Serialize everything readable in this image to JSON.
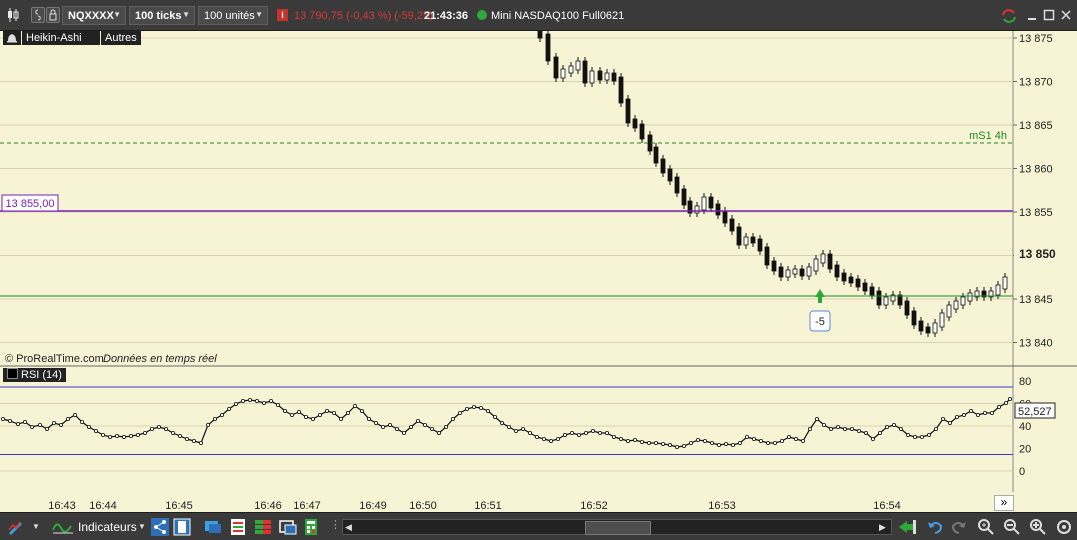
{
  "toolbar": {
    "instrument_code": "NQXXXX",
    "ticks": "100 ticks",
    "units": "100 unités",
    "last_price": "13 790,75 (-0,43 %) (-59,25)",
    "time": "21:43:36",
    "instrument_name": "Mini NASDAQ100 Full0621",
    "status_color": "#2fa83a"
  },
  "legend": {
    "chart_type": "Heikin-Ashi",
    "others": "Autres"
  },
  "main_chart": {
    "watermark": "© ProRealTime.com",
    "realtime": "Données en temps réel",
    "y_ticks": [
      "13 875",
      "13 870",
      "13 865",
      "13 860",
      "13 855",
      "13 850",
      "13 845",
      "13 840"
    ],
    "current_price_label": "13 850",
    "hline_label": "13 855,00",
    "ms1_label": "mS1 4h",
    "order_label": "-5",
    "colors": {
      "purple_line": "#7a1fb3",
      "green_line": "#1e8a1e",
      "arrow": "#2fa83a"
    }
  },
  "rsi": {
    "title": "RSI (14)",
    "y_ticks": [
      "80",
      "60",
      "40",
      "20",
      "0"
    ],
    "current_value": "52,527",
    "colors": {
      "bands": "#3a3ad0"
    }
  },
  "x_axis": {
    "labels": [
      "16:43",
      "16:44",
      "16:45",
      "16:46",
      "16:47",
      "16:49",
      "16:50",
      "16:51",
      "16:52",
      "16:53",
      "16:54"
    ],
    "scroll_glyph": "»"
  },
  "bottom_bar": {
    "indicators_label": "Indicateurs"
  }
}
